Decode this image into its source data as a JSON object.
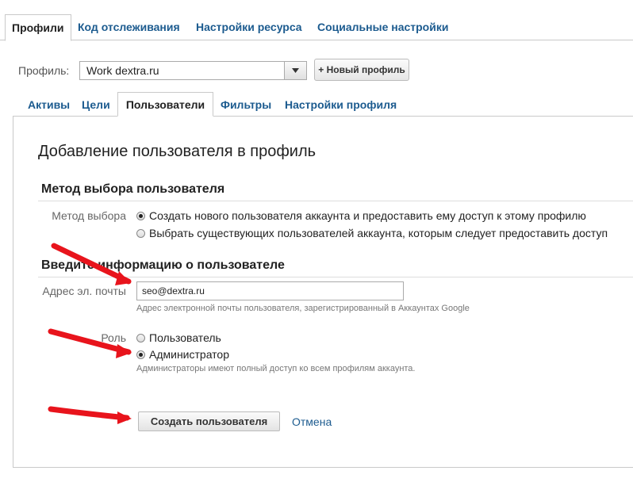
{
  "top_tabs": [
    "Профили",
    "Код отслеживания",
    "Настройки ресурса",
    "Социальные настройки"
  ],
  "profile": {
    "label": "Профиль:",
    "selected": "Work dextra.ru",
    "new_profile_button": "+ Новый профиль"
  },
  "sub_tabs": [
    "Активы",
    "Цели",
    "Пользователи",
    "Фильтры",
    "Настройки профиля"
  ],
  "panel": {
    "title": "Добавление пользователя в профиль",
    "method_section": {
      "heading": "Метод выбора пользователя",
      "label": "Метод выбора",
      "options": [
        {
          "text": "Создать нового пользователя аккаунта и предоставить ему доступ к этому профилю",
          "checked": true
        },
        {
          "text": "Выбрать существующих пользователей аккаунта, которым следует предоставить доступ",
          "checked": false
        }
      ]
    },
    "info_section": {
      "heading": "Введите информацию о пользователе",
      "email_label": "Адрес эл. почты",
      "email_value": "seo@dextra.ru",
      "email_hint": "Адрес электронной почты пользователя, зарегистрированный в Аккаунтах Google",
      "role_label": "Роль",
      "roles": [
        {
          "text": "Пользователь",
          "checked": false
        },
        {
          "text": "Администратор",
          "checked": true
        }
      ],
      "role_hint": "Администраторы имеют полный доступ ко всем профилям аккаунта."
    },
    "create_button": "Создать пользователя",
    "cancel_link": "Отмена"
  },
  "colors": {
    "link": "#1c5b8f",
    "annotation_arrow": "#e8141c"
  }
}
